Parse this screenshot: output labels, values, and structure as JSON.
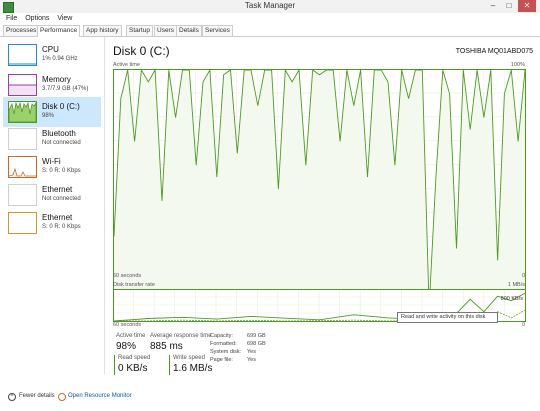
{
  "window": {
    "title": "Task Manager",
    "min": "–",
    "max": "□",
    "close": "✕"
  },
  "menu": [
    "File",
    "Options",
    "View"
  ],
  "tabs": [
    "Processes",
    "Performance",
    "App history",
    "Startup",
    "Users",
    "Details",
    "Services"
  ],
  "active_tab": "Performance",
  "sidebar": [
    {
      "name": "CPU",
      "sub": "1% 0.94 GHz",
      "color": "#1f8fcf"
    },
    {
      "name": "Memory",
      "sub": "3.7/7.9 GB (47%)",
      "color": "#9b3fa6"
    },
    {
      "name": "Disk 0 (C:)",
      "sub": "98%",
      "color": "#4c9b1c"
    },
    {
      "name": "Bluetooth",
      "sub": "Not connected",
      "color": "#b0b0b0"
    },
    {
      "name": "Wi-Fi",
      "sub": "S: 0 R: 0 Kbps",
      "color": "#c86a1a"
    },
    {
      "name": "Ethernet",
      "sub": "Not connected",
      "color": "#b0b0b0"
    },
    {
      "name": "Ethernet",
      "sub": "S: 0 R: 0 Kbps",
      "color": "#c89a2a"
    }
  ],
  "selected_index": 2,
  "main": {
    "title": "Disk 0 (C:)",
    "model": "TOSHIBA MQ01ABD075",
    "active_time_label": "Active time",
    "active_max": "100%",
    "x_left": "60 seconds",
    "x_right": "0",
    "transfer_label": "Disk transfer rate",
    "transfer_max": "1 MB/s",
    "transfer_mark": "800 KB/s",
    "transfer_x_left": "60 seconds",
    "transfer_x_right": "0",
    "tooltip": "Read and write activity on this disk"
  },
  "stats": {
    "active_time_label": "Active time",
    "active_time": "98%",
    "avg_response_label": "Average response time",
    "avg_response": "885 ms",
    "read_label": "Read speed",
    "read_value": "0 KB/s",
    "write_label": "Write speed",
    "write_value": "1.6 MB/s",
    "capacity_label": "Capacity:",
    "capacity": "699 GB",
    "formatted_label": "Formatted:",
    "formatted": "698 GB",
    "system_disk_label": "System disk:",
    "system_disk": "Yes",
    "page_file_label": "Page file:",
    "page_file": "Yes"
  },
  "footer": {
    "fewer_details": "Fewer details",
    "open_resource_monitor": "Open Resource Monitor"
  },
  "chart_data": [
    {
      "type": "line",
      "title": "Active time",
      "ylabel": "",
      "ylim": [
        0,
        100
      ],
      "x": [
        60,
        59,
        58,
        57,
        56,
        55,
        54,
        53,
        52,
        51,
        50,
        49,
        48,
        47,
        46,
        45,
        44,
        43,
        42,
        41,
        40,
        39,
        38,
        37,
        36,
        35,
        34,
        33,
        32,
        31,
        30,
        29,
        28,
        27,
        26,
        25,
        24,
        23,
        22,
        21,
        20,
        19,
        18,
        17,
        16,
        15,
        14,
        13,
        12,
        11,
        10,
        9,
        8,
        7,
        6,
        5,
        4,
        3,
        2,
        1,
        0
      ],
      "values": [
        30,
        88,
        100,
        70,
        100,
        95,
        100,
        45,
        100,
        80,
        100,
        100,
        60,
        95,
        100,
        55,
        98,
        100,
        65,
        100,
        100,
        85,
        100,
        100,
        50,
        100,
        95,
        100,
        60,
        100,
        98,
        100,
        100,
        70,
        100,
        85,
        100,
        55,
        100,
        100,
        95,
        60,
        100,
        88,
        100,
        100,
        0,
        55,
        100,
        90,
        25,
        100,
        75,
        100,
        80,
        100,
        20,
        90,
        100,
        70,
        100
      ],
      "color": "#4c9b1c"
    },
    {
      "type": "line",
      "title": "Disk transfer rate",
      "ylim": [
        0,
        1000
      ],
      "x": [
        60,
        55,
        50,
        45,
        40,
        35,
        30,
        25,
        20,
        15,
        10,
        8,
        6,
        4,
        2,
        0
      ],
      "series": [
        {
          "values": [
            0,
            80,
            120,
            60,
            150,
            90,
            40,
            200,
            100,
            60,
            250,
            700,
            300,
            800,
            650,
            900
          ]
        },
        {
          "values": [
            0,
            0,
            30,
            0,
            20,
            0,
            10,
            30,
            0,
            20,
            40,
            200,
            50,
            300,
            100,
            350
          ]
        }
      ],
      "color": "#4c9b1c"
    }
  ]
}
